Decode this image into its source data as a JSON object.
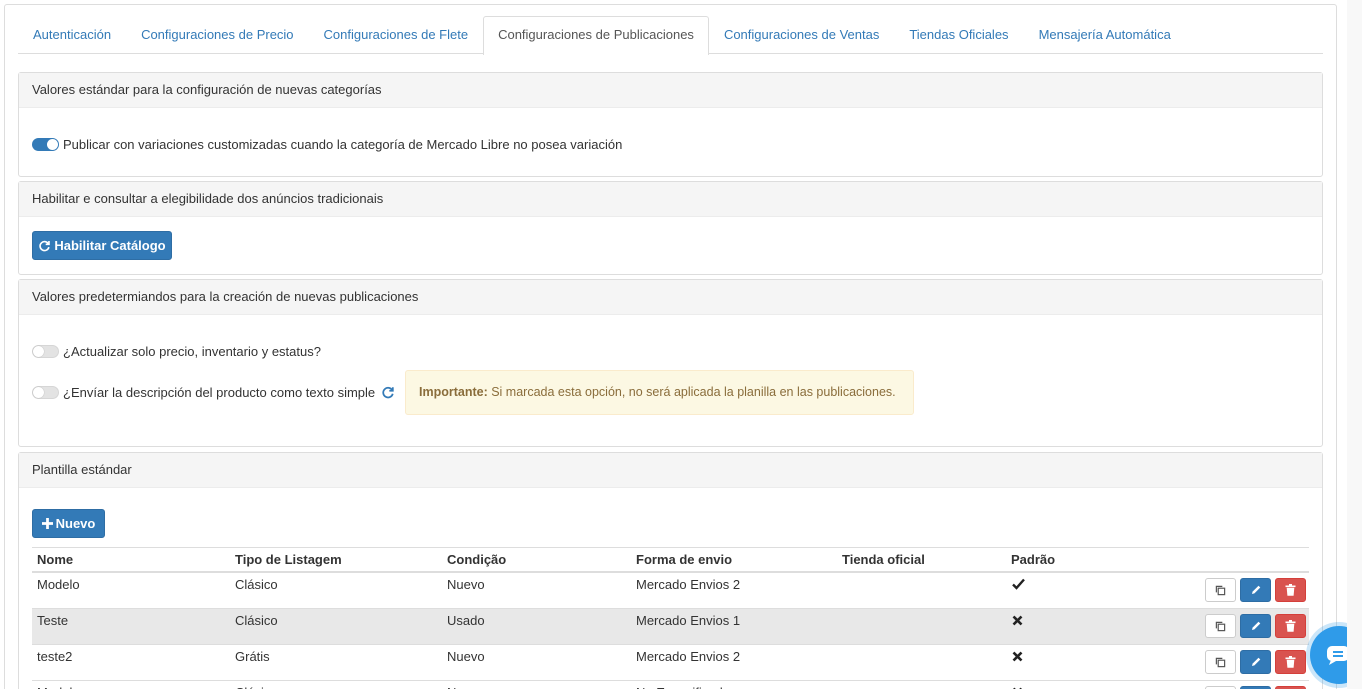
{
  "tabs": [
    {
      "label": "Autenticación",
      "active": false
    },
    {
      "label": "Configuraciones de Precio",
      "active": false
    },
    {
      "label": "Configuraciones de Flete",
      "active": false
    },
    {
      "label": "Configuraciones de Publicaciones",
      "active": true
    },
    {
      "label": "Configuraciones de Ventas",
      "active": false
    },
    {
      "label": "Tiendas Oficiales",
      "active": false
    },
    {
      "label": "Mensajería Automática",
      "active": false
    }
  ],
  "panel_categories": {
    "title": "Valores estándar para la configuración de nuevas categorías",
    "toggle_label": "Publicar con variaciones customizadas cuando la categoría de Mercado Libre no posea variación",
    "toggle_on": true
  },
  "panel_catalog": {
    "title": "Habilitar e consultar a elegibilidade dos anúncios tradicionais",
    "button_label": "Habilitar Catálogo"
  },
  "panel_publications": {
    "title": "Valores predetermiandos para la creación de nuevas publicaciones",
    "toggle1_label": "¿Actualizar solo precio, inventario y estatus?",
    "toggle1_on": false,
    "toggle2_label": "¿Envíar la descripción del producto como texto simple",
    "toggle2_on": false,
    "alert_strong": "Importante:",
    "alert_text": " Si marcada esta opción, no será aplicada la planilla en las publicaciones."
  },
  "panel_template": {
    "title": "Plantilla estándar",
    "new_button_label": "Nuevo",
    "columns": [
      "Nome",
      "Tipo de Listagem",
      "Condição",
      "Forma de envio",
      "Tienda oficial",
      "Padrão"
    ],
    "rows": [
      {
        "nome": "Modelo",
        "tipo": "Clásico",
        "condicao": "Nuevo",
        "envio": "Mercado Envios 2",
        "tienda": "",
        "padrao": true
      },
      {
        "nome": "Teste",
        "tipo": "Clásico",
        "condicao": "Usado",
        "envio": "Mercado Envios 1",
        "tienda": "",
        "padrao": false
      },
      {
        "nome": "teste2",
        "tipo": "Grátis",
        "condicao": "Nuevo",
        "envio": "Mercado Envios 2",
        "tienda": "",
        "padrao": false
      },
      {
        "nome": "Modelo",
        "tipo": "Clásico",
        "condicao": "Nuevo",
        "envio": "No Especificado",
        "tienda": "",
        "padrao": false
      }
    ]
  },
  "colors": {
    "primary": "#337ab7",
    "danger": "#d9534f",
    "warning_bg": "#fcf8e3",
    "chat": "#2f9be9"
  }
}
